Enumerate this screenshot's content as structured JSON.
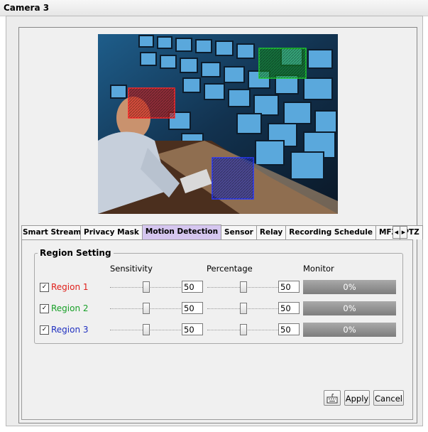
{
  "window": {
    "title": "Camera 3"
  },
  "tabs": [
    {
      "label": "Smart Stream",
      "active": false
    },
    {
      "label": "Privacy Mask",
      "active": false
    },
    {
      "label": "Motion Detection",
      "active": true
    },
    {
      "label": "Sensor",
      "active": false
    },
    {
      "label": "Relay",
      "active": false
    },
    {
      "label": "Recording Schedule",
      "active": false
    },
    {
      "label": "MFZ",
      "active": false
    },
    {
      "label": "PTZ",
      "active": false
    }
  ],
  "region_setting": {
    "title": "Region Setting",
    "headers": {
      "sensitivity": "Sensitivity",
      "percentage": "Percentage",
      "monitor": "Monitor"
    },
    "regions": [
      {
        "label": "Region 1",
        "checked": true,
        "color": "#e0201b",
        "sensitivity": "50",
        "percentage": "50",
        "monitor": "0%"
      },
      {
        "label": "Region 2",
        "checked": true,
        "color": "#18a028",
        "sensitivity": "50",
        "percentage": "50",
        "monitor": "0%"
      },
      {
        "label": "Region 3",
        "checked": true,
        "color": "#2030c0",
        "sensitivity": "50",
        "percentage": "50",
        "monitor": "0%"
      }
    ]
  },
  "buttons": {
    "keyboard_icon": "keyboard-icon",
    "apply": "Apply",
    "cancel": "Cancel"
  },
  "icons": {
    "tab_left": "chevron-left-icon",
    "tab_right": "chevron-right-icon",
    "check": "checkmark-icon"
  }
}
